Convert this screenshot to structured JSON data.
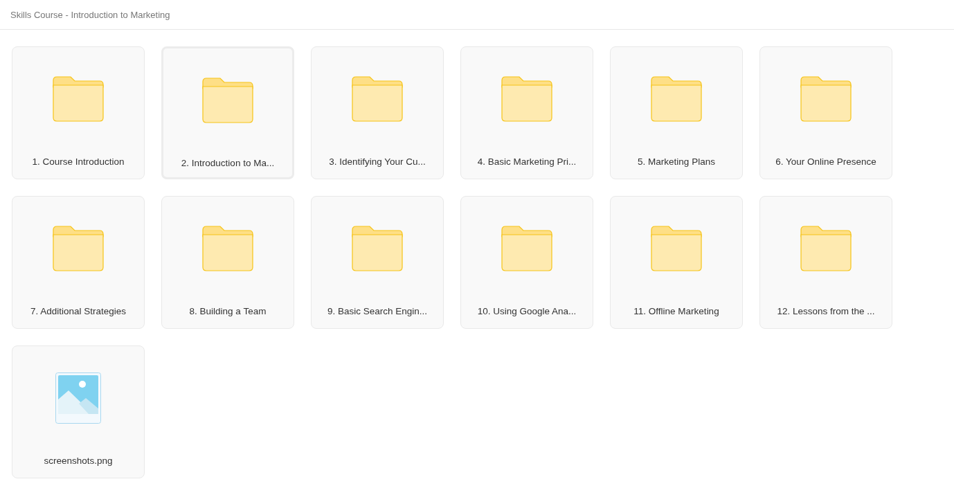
{
  "breadcrumb": "Skills Course - Introduction to Marketing",
  "items": [
    {
      "kind": "folder",
      "name": "1. Course Introduction",
      "selected": false
    },
    {
      "kind": "folder",
      "name": "2. Introduction to Ma...",
      "selected": true
    },
    {
      "kind": "folder",
      "name": "3. Identifying Your Cu...",
      "selected": false
    },
    {
      "kind": "folder",
      "name": "4. Basic Marketing Pri...",
      "selected": false
    },
    {
      "kind": "folder",
      "name": "5. Marketing Plans",
      "selected": false
    },
    {
      "kind": "folder",
      "name": "6. Your Online Presence",
      "selected": false
    },
    {
      "kind": "folder",
      "name": "7. Additional Strategies",
      "selected": false
    },
    {
      "kind": "folder",
      "name": "8. Building a Team",
      "selected": false
    },
    {
      "kind": "folder",
      "name": "9. Basic Search Engin...",
      "selected": false
    },
    {
      "kind": "folder",
      "name": "10. Using Google Ana...",
      "selected": false
    },
    {
      "kind": "folder",
      "name": "11. Offline Marketing",
      "selected": false
    },
    {
      "kind": "folder",
      "name": "12. Lessons from the ...",
      "selected": false
    },
    {
      "kind": "image",
      "name": "screenshots.png",
      "selected": false
    }
  ]
}
